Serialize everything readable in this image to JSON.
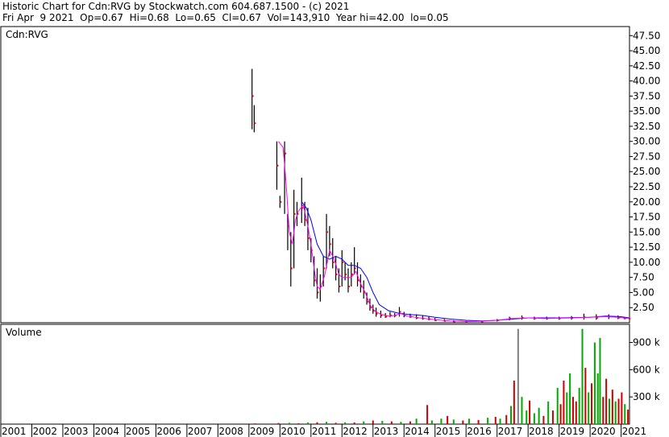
{
  "header": {
    "line1": "Historic Chart for Cdn:RVG by Stockwatch.com 604.687.1500 - (c) 2021",
    "line2": "Fri Apr  9 2021  Op=0.67  Hi=0.68  Lo=0.65  Cl=0.67  Vol=143,910  Year hi=42.00  lo=0.05"
  },
  "colors": {
    "background": "#ffffff",
    "price_bar": "#000000",
    "close_tick": "#ff0000",
    "ma_short": "#ff00ff",
    "ma_long": "#0000ff",
    "volume_up": "#00aa00",
    "volume_down": "#cc0000",
    "volume_flat": "#808080",
    "frame": "#000000"
  },
  "chart_data": [
    {
      "type": "line",
      "panel": "price",
      "title": "Cdn:RVG",
      "xlabel": "",
      "ylabel": "",
      "ylim": [
        0,
        49
      ],
      "yticks": [
        2.5,
        5.0,
        7.5,
        10.0,
        12.5,
        15.0,
        17.5,
        20.0,
        22.5,
        25.0,
        27.5,
        30.0,
        32.5,
        35.0,
        37.5,
        40.0,
        42.5,
        45.0,
        47.5
      ],
      "ytick_labels": [
        "2.50",
        "5.00",
        "7.50",
        "10.00",
        "12.50",
        "15.00",
        "17.50",
        "20.00",
        "22.50",
        "25.00",
        "27.50",
        "30.00",
        "32.50",
        "35.00",
        "37.50",
        "40.00",
        "42.50",
        "45.00",
        "47.50"
      ],
      "x_labels": [
        "2001",
        "2002",
        "2003",
        "2004",
        "2005",
        "2006",
        "2007",
        "2008",
        "2009",
        "2010",
        "2011",
        "2012",
        "2013",
        "2014",
        "2015",
        "2016",
        "2017",
        "2018",
        "2019",
        "2020",
        "2021"
      ],
      "xlim": [
        2001.0,
        2021.27
      ],
      "grid": false,
      "bars": [
        {
          "x": 2009.1,
          "hi": 42.0,
          "lo": 32.0,
          "cl": 37.5
        },
        {
          "x": 2009.17,
          "hi": 36.0,
          "lo": 31.5,
          "cl": 33.0
        },
        {
          "x": 2009.9,
          "hi": 30.0,
          "lo": 22.0,
          "cl": 26.0
        },
        {
          "x": 2010.0,
          "hi": 21.0,
          "lo": 19.0,
          "cl": 20.0
        },
        {
          "x": 2010.15,
          "hi": 30.0,
          "lo": 18.0,
          "cl": 28.0
        },
        {
          "x": 2010.25,
          "hi": 18.0,
          "lo": 12.0,
          "cl": 16.0
        },
        {
          "x": 2010.35,
          "hi": 15.0,
          "lo": 6.0,
          "cl": 9.0
        },
        {
          "x": 2010.45,
          "hi": 22.0,
          "lo": 9.0,
          "cl": 18.0
        },
        {
          "x": 2010.55,
          "hi": 20.0,
          "lo": 16.0,
          "cl": 18.0
        },
        {
          "x": 2010.7,
          "hi": 24.0,
          "lo": 16.5,
          "cl": 19.0
        },
        {
          "x": 2010.8,
          "hi": 20.0,
          "lo": 16.0,
          "cl": 17.0
        },
        {
          "x": 2010.9,
          "hi": 19.0,
          "lo": 12.0,
          "cl": 14.0
        },
        {
          "x": 2011.0,
          "hi": 14.0,
          "lo": 10.0,
          "cl": 12.0
        },
        {
          "x": 2011.1,
          "hi": 11.0,
          "lo": 6.0,
          "cl": 7.0
        },
        {
          "x": 2011.2,
          "hi": 9.0,
          "lo": 4.0,
          "cl": 5.0
        },
        {
          "x": 2011.3,
          "hi": 8.0,
          "lo": 3.5,
          "cl": 6.0
        },
        {
          "x": 2011.4,
          "hi": 11.0,
          "lo": 6.0,
          "cl": 9.0
        },
        {
          "x": 2011.5,
          "hi": 18.0,
          "lo": 9.0,
          "cl": 15.0
        },
        {
          "x": 2011.6,
          "hi": 16.0,
          "lo": 11.0,
          "cl": 13.0
        },
        {
          "x": 2011.7,
          "hi": 14.0,
          "lo": 9.0,
          "cl": 10.0
        },
        {
          "x": 2011.8,
          "hi": 11.0,
          "lo": 7.0,
          "cl": 8.0
        },
        {
          "x": 2011.9,
          "hi": 9.0,
          "lo": 5.0,
          "cl": 6.0
        },
        {
          "x": 2012.0,
          "hi": 12.0,
          "lo": 6.0,
          "cl": 10.0
        },
        {
          "x": 2012.1,
          "hi": 10.0,
          "lo": 7.0,
          "cl": 8.0
        },
        {
          "x": 2012.2,
          "hi": 9.0,
          "lo": 5.0,
          "cl": 6.0
        },
        {
          "x": 2012.3,
          "hi": 10.0,
          "lo": 6.0,
          "cl": 8.0
        },
        {
          "x": 2012.4,
          "hi": 12.5,
          "lo": 8.0,
          "cl": 9.0
        },
        {
          "x": 2012.5,
          "hi": 10.0,
          "lo": 6.0,
          "cl": 7.0
        },
        {
          "x": 2012.6,
          "hi": 8.0,
          "lo": 5.0,
          "cl": 6.0
        },
        {
          "x": 2012.7,
          "hi": 7.0,
          "lo": 4.0,
          "cl": 5.0
        },
        {
          "x": 2012.8,
          "hi": 5.0,
          "lo": 3.0,
          "cl": 3.5
        },
        {
          "x": 2012.9,
          "hi": 4.0,
          "lo": 2.0,
          "cl": 2.5
        },
        {
          "x": 2013.0,
          "hi": 3.0,
          "lo": 1.5,
          "cl": 2.0
        },
        {
          "x": 2013.1,
          "hi": 2.5,
          "lo": 1.0,
          "cl": 1.5
        },
        {
          "x": 2013.25,
          "hi": 2.0,
          "lo": 0.8,
          "cl": 1.2
        },
        {
          "x": 2013.4,
          "hi": 1.6,
          "lo": 0.8,
          "cl": 1.0
        },
        {
          "x": 2013.55,
          "hi": 1.8,
          "lo": 0.9,
          "cl": 1.2
        },
        {
          "x": 2013.7,
          "hi": 1.6,
          "lo": 0.9,
          "cl": 1.2
        },
        {
          "x": 2013.85,
          "hi": 2.6,
          "lo": 1.0,
          "cl": 1.8
        },
        {
          "x": 2014.0,
          "hi": 1.8,
          "lo": 0.9,
          "cl": 1.2
        },
        {
          "x": 2014.2,
          "hi": 1.5,
          "lo": 0.8,
          "cl": 1.0
        },
        {
          "x": 2014.4,
          "hi": 1.4,
          "lo": 0.6,
          "cl": 0.8
        },
        {
          "x": 2014.6,
          "hi": 1.2,
          "lo": 0.5,
          "cl": 0.7
        },
        {
          "x": 2014.8,
          "hi": 1.0,
          "lo": 0.4,
          "cl": 0.6
        },
        {
          "x": 2015.0,
          "hi": 0.8,
          "lo": 0.3,
          "cl": 0.4
        },
        {
          "x": 2015.3,
          "hi": 0.6,
          "lo": 0.2,
          "cl": 0.3
        },
        {
          "x": 2015.6,
          "hi": 0.4,
          "lo": 0.1,
          "cl": 0.2
        },
        {
          "x": 2016.0,
          "hi": 0.3,
          "lo": 0.05,
          "cl": 0.15
        },
        {
          "x": 2016.5,
          "hi": 0.3,
          "lo": 0.1,
          "cl": 0.2
        },
        {
          "x": 2017.0,
          "hi": 0.6,
          "lo": 0.2,
          "cl": 0.4
        },
        {
          "x": 2017.4,
          "hi": 1.0,
          "lo": 0.4,
          "cl": 0.7
        },
        {
          "x": 2017.8,
          "hi": 1.2,
          "lo": 0.5,
          "cl": 0.8
        },
        {
          "x": 2018.2,
          "hi": 1.0,
          "lo": 0.5,
          "cl": 0.7
        },
        {
          "x": 2018.6,
          "hi": 1.0,
          "lo": 0.5,
          "cl": 0.7
        },
        {
          "x": 2019.0,
          "hi": 1.0,
          "lo": 0.5,
          "cl": 0.7
        },
        {
          "x": 2019.4,
          "hi": 1.1,
          "lo": 0.5,
          "cl": 0.8
        },
        {
          "x": 2019.8,
          "hi": 1.5,
          "lo": 0.5,
          "cl": 0.9
        },
        {
          "x": 2020.2,
          "hi": 1.4,
          "lo": 0.5,
          "cl": 0.8
        },
        {
          "x": 2020.6,
          "hi": 1.4,
          "lo": 0.6,
          "cl": 1.0
        },
        {
          "x": 2020.9,
          "hi": 1.2,
          "lo": 0.6,
          "cl": 0.8
        },
        {
          "x": 2021.1,
          "hi": 0.9,
          "lo": 0.6,
          "cl": 0.7
        },
        {
          "x": 2021.25,
          "hi": 0.68,
          "lo": 0.65,
          "cl": 0.67
        }
      ],
      "ma_short": [
        [
          2009.95,
          30.0
        ],
        [
          2010.1,
          29.0
        ],
        [
          2010.2,
          23.0
        ],
        [
          2010.3,
          15.0
        ],
        [
          2010.4,
          13.0
        ],
        [
          2010.5,
          17.0
        ],
        [
          2010.6,
          18.5
        ],
        [
          2010.75,
          19.5
        ],
        [
          2010.9,
          16.0
        ],
        [
          2011.0,
          13.0
        ],
        [
          2011.1,
          9.0
        ],
        [
          2011.2,
          6.0
        ],
        [
          2011.3,
          5.5
        ],
        [
          2011.45,
          8.0
        ],
        [
          2011.6,
          12.0
        ],
        [
          2011.75,
          10.5
        ],
        [
          2011.9,
          8.0
        ],
        [
          2012.0,
          7.5
        ],
        [
          2012.15,
          7.5
        ],
        [
          2012.3,
          7.5
        ],
        [
          2012.45,
          8.5
        ],
        [
          2012.6,
          6.5
        ],
        [
          2012.75,
          5.0
        ],
        [
          2012.9,
          3.0
        ],
        [
          2013.05,
          2.0
        ],
        [
          2013.25,
          1.4
        ],
        [
          2013.5,
          1.1
        ],
        [
          2013.7,
          1.2
        ],
        [
          2013.9,
          1.5
        ],
        [
          2014.1,
          1.1
        ],
        [
          2014.5,
          0.8
        ],
        [
          2015.0,
          0.5
        ],
        [
          2015.5,
          0.3
        ],
        [
          2016.0,
          0.2
        ],
        [
          2016.5,
          0.25
        ],
        [
          2017.0,
          0.4
        ],
        [
          2017.5,
          0.7
        ],
        [
          2018.0,
          0.8
        ],
        [
          2018.5,
          0.7
        ],
        [
          2019.0,
          0.75
        ],
        [
          2019.5,
          0.8
        ],
        [
          2020.0,
          0.9
        ],
        [
          2020.5,
          1.0
        ],
        [
          2020.9,
          0.9
        ],
        [
          2021.25,
          0.7
        ]
      ],
      "ma_long": [
        [
          2010.7,
          20.0
        ],
        [
          2010.85,
          19.0
        ],
        [
          2011.0,
          17.0
        ],
        [
          2011.2,
          13.0
        ],
        [
          2011.4,
          11.0
        ],
        [
          2011.6,
          10.5
        ],
        [
          2011.8,
          11.0
        ],
        [
          2012.0,
          10.5
        ],
        [
          2012.2,
          9.5
        ],
        [
          2012.4,
          9.5
        ],
        [
          2012.6,
          9.0
        ],
        [
          2012.8,
          7.5
        ],
        [
          2013.0,
          5.0
        ],
        [
          2013.2,
          3.0
        ],
        [
          2013.5,
          2.0
        ],
        [
          2013.8,
          1.6
        ],
        [
          2014.1,
          1.4
        ],
        [
          2014.6,
          1.2
        ],
        [
          2015.0,
          0.9
        ],
        [
          2015.5,
          0.6
        ],
        [
          2016.0,
          0.4
        ],
        [
          2016.5,
          0.3
        ],
        [
          2017.0,
          0.4
        ],
        [
          2017.5,
          0.6
        ],
        [
          2018.0,
          0.8
        ],
        [
          2018.5,
          0.8
        ],
        [
          2019.0,
          0.8
        ],
        [
          2019.5,
          0.85
        ],
        [
          2020.0,
          0.9
        ],
        [
          2020.5,
          1.1
        ],
        [
          2021.0,
          1.0
        ],
        [
          2021.25,
          0.8
        ]
      ]
    },
    {
      "type": "bar",
      "panel": "volume",
      "title": "Volume",
      "ylim": [
        0,
        1100000
      ],
      "yticks": [
        300000,
        600000,
        900000
      ],
      "ytick_labels": [
        "300 k",
        "600 k",
        "900 k"
      ],
      "x_labels": [
        "2001",
        "2002",
        "2003",
        "2004",
        "2005",
        "2006",
        "2007",
        "2008",
        "2009",
        "2010",
        "2011",
        "2012",
        "2013",
        "2014",
        "2015",
        "2016",
        "2017",
        "2018",
        "2019",
        "2020",
        "2021"
      ],
      "bars": [
        {
          "x": 2009.2,
          "v": 8000,
          "c": "down"
        },
        {
          "x": 2009.95,
          "v": 12000,
          "c": "down"
        },
        {
          "x": 2010.3,
          "v": 15000,
          "c": "up"
        },
        {
          "x": 2010.6,
          "v": 10000,
          "c": "down"
        },
        {
          "x": 2010.9,
          "v": 18000,
          "c": "up"
        },
        {
          "x": 2011.2,
          "v": 20000,
          "c": "down"
        },
        {
          "x": 2011.5,
          "v": 25000,
          "c": "up"
        },
        {
          "x": 2011.8,
          "v": 15000,
          "c": "down"
        },
        {
          "x": 2012.1,
          "v": 20000,
          "c": "up"
        },
        {
          "x": 2012.4,
          "v": 18000,
          "c": "down"
        },
        {
          "x": 2012.7,
          "v": 30000,
          "c": "up"
        },
        {
          "x": 2013.0,
          "v": 40000,
          "c": "down"
        },
        {
          "x": 2013.3,
          "v": 35000,
          "c": "up"
        },
        {
          "x": 2013.6,
          "v": 30000,
          "c": "down"
        },
        {
          "x": 2013.9,
          "v": 25000,
          "c": "up"
        },
        {
          "x": 2014.2,
          "v": 30000,
          "c": "down"
        },
        {
          "x": 2014.4,
          "v": 60000,
          "c": "up"
        },
        {
          "x": 2014.75,
          "v": 210000,
          "c": "down"
        },
        {
          "x": 2014.9,
          "v": 40000,
          "c": "up"
        },
        {
          "x": 2015.2,
          "v": 60000,
          "c": "up"
        },
        {
          "x": 2015.4,
          "v": 90000,
          "c": "down"
        },
        {
          "x": 2015.6,
          "v": 50000,
          "c": "up"
        },
        {
          "x": 2015.9,
          "v": 40000,
          "c": "down"
        },
        {
          "x": 2016.1,
          "v": 60000,
          "c": "up"
        },
        {
          "x": 2016.4,
          "v": 45000,
          "c": "down"
        },
        {
          "x": 2016.7,
          "v": 70000,
          "c": "up"
        },
        {
          "x": 2016.95,
          "v": 80000,
          "c": "down"
        },
        {
          "x": 2017.1,
          "v": 60000,
          "c": "up"
        },
        {
          "x": 2017.3,
          "v": 100000,
          "c": "down"
        },
        {
          "x": 2017.45,
          "v": 200000,
          "c": "up"
        },
        {
          "x": 2017.55,
          "v": 480000,
          "c": "down"
        },
        {
          "x": 2017.68,
          "v": 1050000,
          "c": "flat"
        },
        {
          "x": 2017.8,
          "v": 300000,
          "c": "up"
        },
        {
          "x": 2017.95,
          "v": 150000,
          "c": "up"
        },
        {
          "x": 2018.05,
          "v": 260000,
          "c": "down"
        },
        {
          "x": 2018.2,
          "v": 120000,
          "c": "up"
        },
        {
          "x": 2018.35,
          "v": 180000,
          "c": "up"
        },
        {
          "x": 2018.5,
          "v": 90000,
          "c": "down"
        },
        {
          "x": 2018.65,
          "v": 250000,
          "c": "up"
        },
        {
          "x": 2018.8,
          "v": 150000,
          "c": "down"
        },
        {
          "x": 2018.95,
          "v": 400000,
          "c": "up"
        },
        {
          "x": 2019.05,
          "v": 220000,
          "c": "down"
        },
        {
          "x": 2019.15,
          "v": 480000,
          "c": "down"
        },
        {
          "x": 2019.25,
          "v": 350000,
          "c": "up"
        },
        {
          "x": 2019.35,
          "v": 560000,
          "c": "up"
        },
        {
          "x": 2019.45,
          "v": 300000,
          "c": "down"
        },
        {
          "x": 2019.55,
          "v": 250000,
          "c": "down"
        },
        {
          "x": 2019.65,
          "v": 400000,
          "c": "up"
        },
        {
          "x": 2019.75,
          "v": 1050000,
          "c": "up"
        },
        {
          "x": 2019.85,
          "v": 620000,
          "c": "down"
        },
        {
          "x": 2019.95,
          "v": 350000,
          "c": "up"
        },
        {
          "x": 2020.05,
          "v": 450000,
          "c": "down"
        },
        {
          "x": 2020.15,
          "v": 900000,
          "c": "up"
        },
        {
          "x": 2020.25,
          "v": 560000,
          "c": "up"
        },
        {
          "x": 2020.32,
          "v": 950000,
          "c": "up"
        },
        {
          "x": 2020.42,
          "v": 300000,
          "c": "down"
        },
        {
          "x": 2020.52,
          "v": 500000,
          "c": "down"
        },
        {
          "x": 2020.62,
          "v": 280000,
          "c": "up"
        },
        {
          "x": 2020.72,
          "v": 380000,
          "c": "down"
        },
        {
          "x": 2020.82,
          "v": 250000,
          "c": "up"
        },
        {
          "x": 2020.92,
          "v": 280000,
          "c": "down"
        },
        {
          "x": 2021.02,
          "v": 350000,
          "c": "down"
        },
        {
          "x": 2021.12,
          "v": 220000,
          "c": "up"
        },
        {
          "x": 2021.22,
          "v": 160000,
          "c": "down"
        }
      ]
    }
  ]
}
